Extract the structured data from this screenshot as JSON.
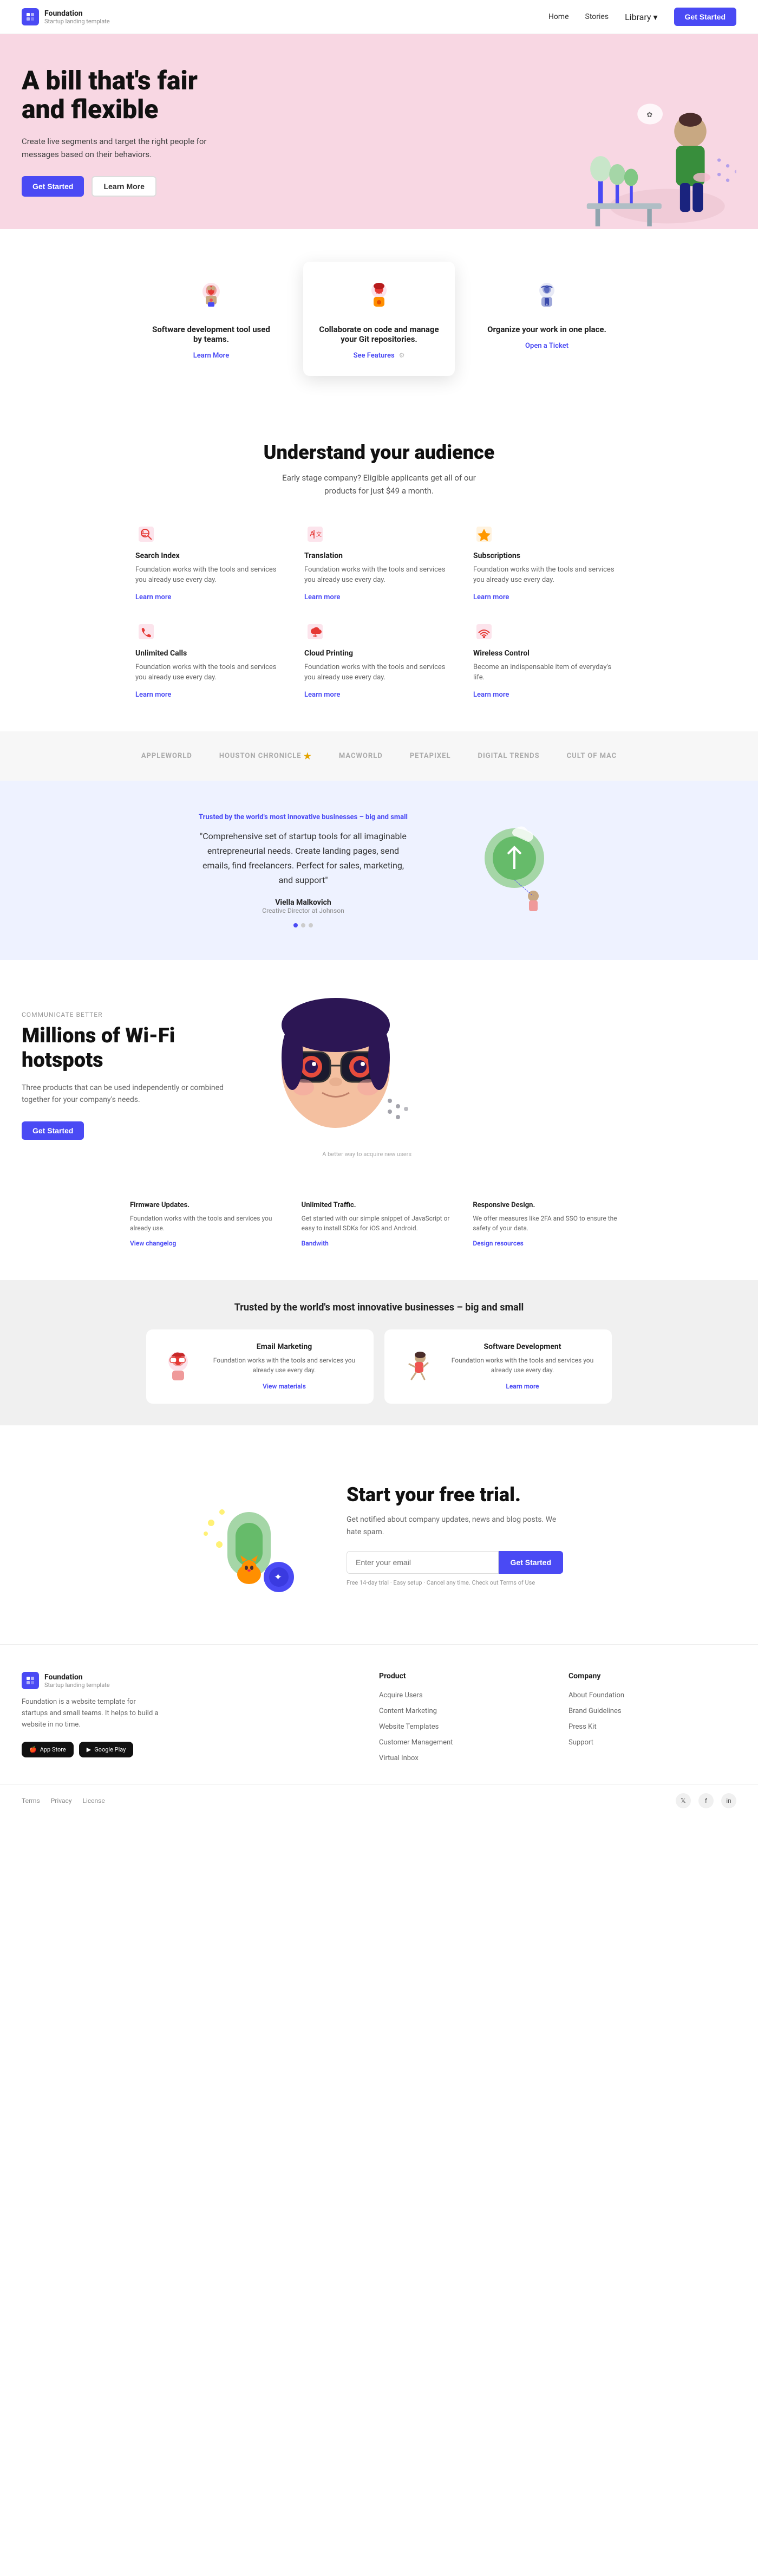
{
  "nav": {
    "logo_text": "Foundation",
    "logo_sub": "Startup landing template",
    "links": [
      "Home",
      "Stories",
      "Library"
    ],
    "library_dropdown": true,
    "cta_label": "Get Started"
  },
  "hero": {
    "headline": "A bill that's fair and flexible",
    "description": "Create live segments and target the right people for messages based on their behaviors.",
    "btn_primary": "Get Started",
    "btn_secondary": "Learn More"
  },
  "features_cards": {
    "cards": [
      {
        "title": "Software development tool used by teams.",
        "link_label": "Learn More",
        "icon": "dev-icon"
      },
      {
        "title": "Collaborate on code and manage your Git repositories.",
        "link_label": "See Features",
        "icon": "git-icon",
        "active": true
      },
      {
        "title": "Organize your work in one place.",
        "link_label": "Open a Ticket",
        "icon": "org-icon"
      }
    ]
  },
  "audience": {
    "heading": "Understand your audience",
    "subtext": "Early stage company? Eligible applicants get all of our products for just $49 a month.",
    "items": [
      {
        "title": "Search Index",
        "desc": "Foundation works with the tools and services you already use every day.",
        "link": "Learn more",
        "icon": "search-index-icon"
      },
      {
        "title": "Translation",
        "desc": "Foundation works with the tools and services you already use every day.",
        "link": "Learn more",
        "icon": "translation-icon"
      },
      {
        "title": "Subscriptions",
        "desc": "Foundation works with the tools and services you already use every day.",
        "link": "Learn more",
        "icon": "subscriptions-icon"
      },
      {
        "title": "Unlimited Calls",
        "desc": "Foundation works with the tools and services you already use every day.",
        "link": "Learn more",
        "icon": "calls-icon"
      },
      {
        "title": "Cloud Printing",
        "desc": "Foundation works with the tools and services you already use every day.",
        "link": "Learn more",
        "icon": "cloud-icon"
      },
      {
        "title": "Wireless Control",
        "desc": "Become an indispensable item of everyday's life.",
        "link": "Learn more",
        "icon": "wireless-icon"
      }
    ]
  },
  "logos": {
    "items": [
      "AppleWorld",
      "Houston Chronicle",
      "Macworld",
      "PetaPixel",
      "DIGITAL TRENDS",
      "Cult of Mac"
    ]
  },
  "testimonial": {
    "label": "Trusted by the world's most innovative businesses – big and small",
    "quote": "\"Comprehensive set of startup tools for all imaginable entrepreneurial needs. Create landing pages, send emails, find freelancers. Perfect for sales, marketing, and support\"",
    "author_name": "Viella Malkovich",
    "author_title": "Creative Director at Johnson"
  },
  "wifi": {
    "label": "Communicate Better",
    "heading": "Millions of Wi-Fi hotspots",
    "desc": "Three products that can be used independently or combined together for your company's needs.",
    "btn_label": "Get Started",
    "caption": "A better way to acquire new users"
  },
  "features_row": {
    "items": [
      {
        "title": "Firmware Updates.",
        "desc": "Foundation works with the tools and services you already use.",
        "link": "View changelog"
      },
      {
        "title": "Unlimited Traffic.",
        "desc": "Get started with our simple snippet of JavaScript or easy to install SDKs for iOS and Android.",
        "link": "Bandwith"
      },
      {
        "title": "Responsive Design.",
        "desc": "We offer measures like 2FA and SSO to ensure the safety of your data.",
        "link": "Design resources"
      }
    ]
  },
  "trusted": {
    "heading": "Trusted by the world's most innovative businesses – big and small",
    "cards": [
      {
        "title": "Email Marketing",
        "desc": "Foundation works with the tools and services you already use every day.",
        "link": "View materials",
        "icon": "email-marketing-icon"
      },
      {
        "title": "Software Development",
        "desc": "Foundation works with the tools and services you already use every day.",
        "link": "Learn more",
        "icon": "software-dev-icon"
      }
    ]
  },
  "cta": {
    "heading": "Start your free trial.",
    "desc": "Get notified about company updates, news and blog posts. We hate spam.",
    "input_placeholder": "Enter your email",
    "btn_label": "Get Started",
    "note": "Free 14-day trial · Easy setup · Cancel any time. Check out Terms of Use"
  },
  "footer": {
    "logo_text": "Foundation",
    "logo_sub": "Startup landing template",
    "brand_desc": "Foundation is a website template for startups and small teams. It helps to build a website in no time.",
    "app_store": "App Store",
    "google_play": "Google Play",
    "product_col": {
      "heading": "Product",
      "links": [
        "Acquire Users",
        "Content Marketing",
        "Website Templates",
        "Customer Management",
        "Virtual Inbox"
      ]
    },
    "company_col": {
      "heading": "Company",
      "links": [
        "About Foundation",
        "Brand Guidelines",
        "Press Kit",
        "Support"
      ]
    },
    "bottom_links": [
      "Terms",
      "Privacy",
      "License"
    ],
    "social": [
      "twitter",
      "facebook",
      "linkedin"
    ]
  },
  "icons": {
    "dev_color": "#e74c3c",
    "git_color": "#e74c3c",
    "org_color": "#4a4af4",
    "search_color": "#e74c3c",
    "translation_color": "#e74c3c",
    "subscriptions_color": "#e67e22",
    "calls_color": "#e74c3c",
    "cloud_color": "#e74c3c",
    "wireless_color": "#e74c3c"
  }
}
